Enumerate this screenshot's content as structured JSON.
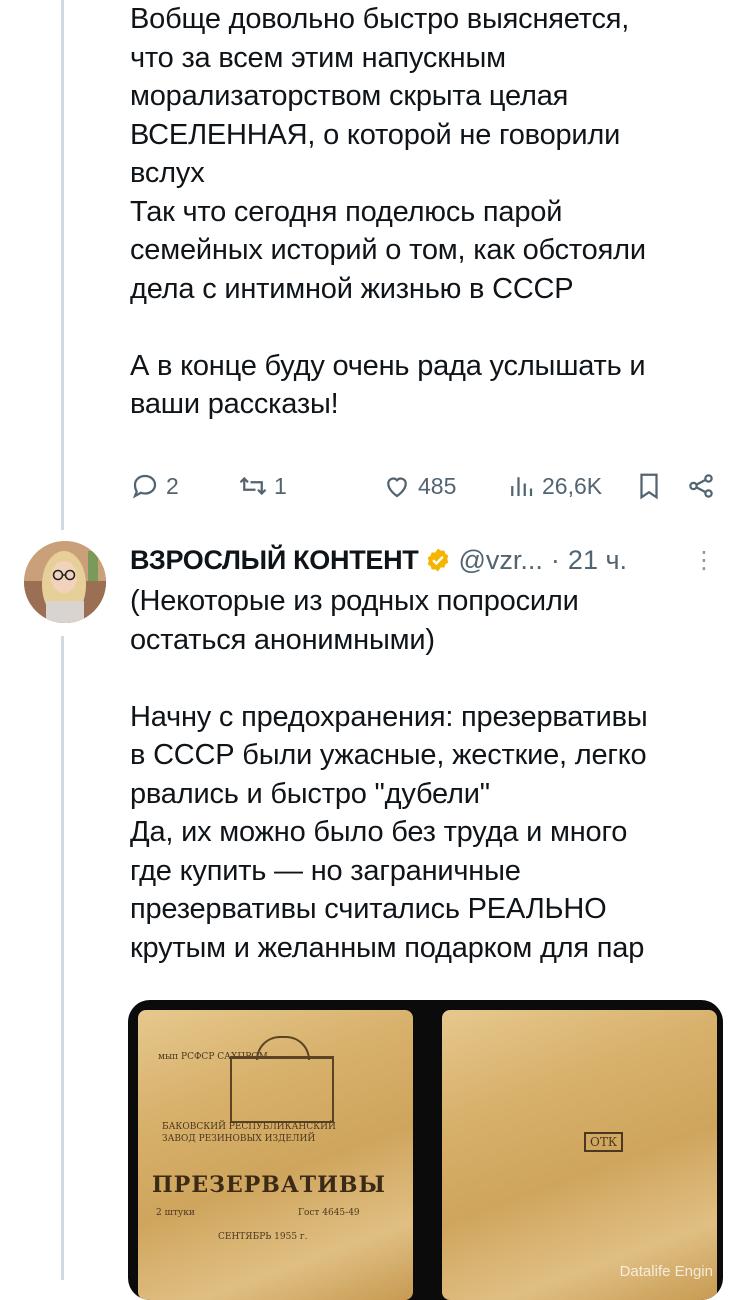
{
  "tweet1": {
    "text": "Вобще довольно быстро выясняется,\nчто за всем этим напускным\nморализаторством скрыта целая\nВСЕЛЕННАЯ, о которой не говорили\nвслух\nТак что сегодня поделюсь парой\nсемейных историй о том, как обстояли\nдела с интимной жизнью в СССР\n\nА в конце буду очень рада услышать и\nваши рассказы!",
    "replies": "2",
    "retweets": "1",
    "likes": "485",
    "views": "26,6K"
  },
  "tweet2": {
    "display_name": "ВЗРОСЛЫЙ КОНТЕНТ",
    "handle": "@vzr...",
    "separator": "·",
    "time": "21 ч.",
    "more": "⋮",
    "text": "(Некоторые из родных попросили\nостаться анонимными)\n\nНачну с предохранения: презервативы\nв СССР были ужасные, жесткие, легко\nрвались и быстро \"дубели\"\nДа, их можно было без труда и много\nгде купить — но заграничные\nпрезервативы считались РЕАЛЬНО\nкрутым и желанным подарком для пар"
  },
  "media": {
    "packet_title": "ПРЕЗЕРВАТИВЫ",
    "top_line": "мып РСФСР   САХПРОМ",
    "factory_line1": "БАКОВСКИЙ РЕСПУБЛИКАНСКИЙ",
    "factory_line2": "ЗАВОД РЕЗИНОВЫХ ИЗДЕЛИЙ",
    "qty": "2 штуки",
    "gost": "Гост 4645-49",
    "date": "СЕНТЯБРЬ 1955 г.",
    "stamp": "ОТК",
    "watermark": "Datalife Engin"
  },
  "colors": {
    "text": "#0f1419",
    "secondary": "#536471",
    "verified": "#f4b400"
  },
  "icons": [
    "reply-icon",
    "retweet-icon",
    "like-icon",
    "views-icon",
    "bookmark-icon",
    "share-icon",
    "verified-badge-icon"
  ]
}
